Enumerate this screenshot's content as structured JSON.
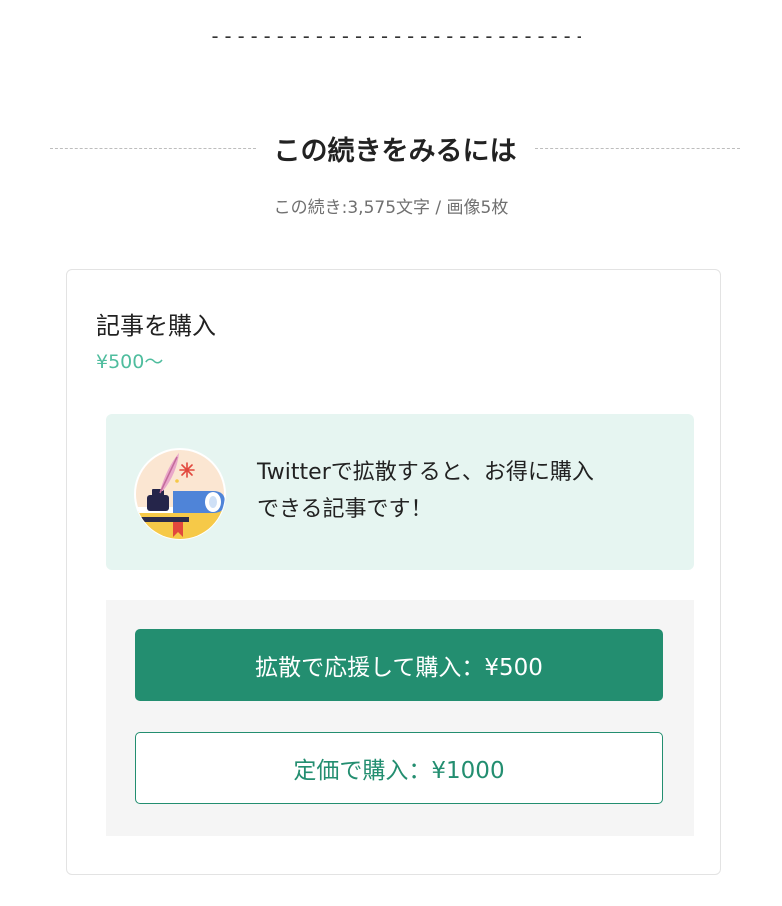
{
  "divider": {
    "dashes": "-----------------------------"
  },
  "section": {
    "heading": "この続きをみるには",
    "subinfo": "この続き:3,575文字 / 画像5枚"
  },
  "card": {
    "title": "記事を購入",
    "price": "¥500〜",
    "promo": {
      "line1": "Twitterで拡散すると、お得に購入",
      "line2": "できる記事です！",
      "illustration": "ink-pen-book-illustration"
    },
    "buttons": {
      "share_purchase": "拡散で応援して購入：¥500",
      "regular_purchase": "定価で購入：¥1000"
    }
  },
  "colors": {
    "accent": "#238e70",
    "price": "#4fbd9e",
    "promo_bg": "#e6f5f1"
  }
}
